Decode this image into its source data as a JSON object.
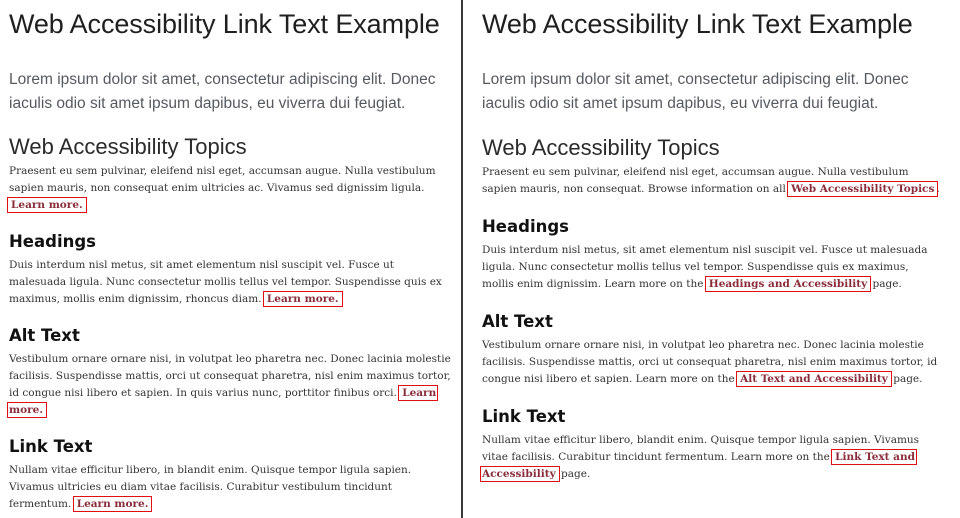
{
  "left": {
    "title": "Web Accessibility Link Text Example",
    "lead": "Lorem ipsum dolor sit amet, consectetur adipiscing elit. Donec iaculis odio sit amet ipsum dapibus, eu viverra dui feugiat.",
    "topics_heading": "Web Accessibility Topics",
    "topics_text": "Praesent eu sem pulvinar, eleifend nisl eget, accumsan augue. Nulla vestibulum sapien mauris, non consequat enim ultricies ac. Vivamus sed dignissim ligula.",
    "topics_link": "Learn more.",
    "sections": [
      {
        "heading": "Headings",
        "text": "Duis interdum nisl metus, sit amet elementum nisl suscipit vel. Fusce ut malesuada ligula. Nunc consectetur mollis tellus vel tempor. Suspendisse quis ex maximus, mollis enim dignissim, rhoncus diam.",
        "link": "Learn more."
      },
      {
        "heading": "Alt Text",
        "text": "Vestibulum ornare ornare nisi, in volutpat leo pharetra nec. Donec lacinia molestie facilisis. Suspendisse mattis, orci ut consequat pharetra, nisl enim maximus tortor, id congue nisi libero et sapien. In quis varius nunc, porttitor finibus orci.",
        "link": "Learn more."
      },
      {
        "heading": "Link Text",
        "text": "Nullam vitae efficitur libero, in blandit enim. Quisque tempor ligula sapien. Vivamus ultricies eu diam vitae facilisis. Curabitur vestibulum tincidunt fermentum.",
        "link": "Learn more."
      }
    ]
  },
  "right": {
    "title": "Web Accessibility Link Text Example",
    "lead": "Lorem ipsum dolor sit amet, consectetur adipiscing elit. Donec iaculis odio sit amet ipsum dapibus, eu viverra dui feugiat.",
    "topics_heading": "Web Accessibility Topics",
    "topics_text": "Praesent eu sem pulvinar, eleifend nisl eget, accumsan augue. Nulla vestibulum sapien mauris, non consequat. Browse information on all",
    "topics_link": "Web Accessibility Topics",
    "topics_after": ".",
    "sections": [
      {
        "heading": "Headings",
        "text": "Duis interdum nisl metus, sit amet elementum nisl suscipit vel. Fusce ut malesuada ligula. Nunc consectetur mollis tellus vel tempor. Suspendisse quis ex maximus, mollis enim dignissim. Learn more on the",
        "link": "Headings and Accessibility",
        "after": "page."
      },
      {
        "heading": "Alt Text",
        "text": "Vestibulum ornare ornare nisi, in volutpat leo pharetra nec. Donec lacinia molestie facilisis. Suspendisse mattis, orci ut consequat pharetra, nisl enim maximus tortor, id congue nisi libero et sapien. Learn more on the",
        "link": "Alt Text and Accessibility",
        "after": "page."
      },
      {
        "heading": "Link Text",
        "text": "Nullam vitae efficitur libero, blandit enim. Quisque tempor ligula sapien. Vivamus vitae facilisis. Curabitur tincidunt fermentum. Learn more on the",
        "link": "Link Text and Accessibility",
        "after": "page."
      }
    ]
  }
}
